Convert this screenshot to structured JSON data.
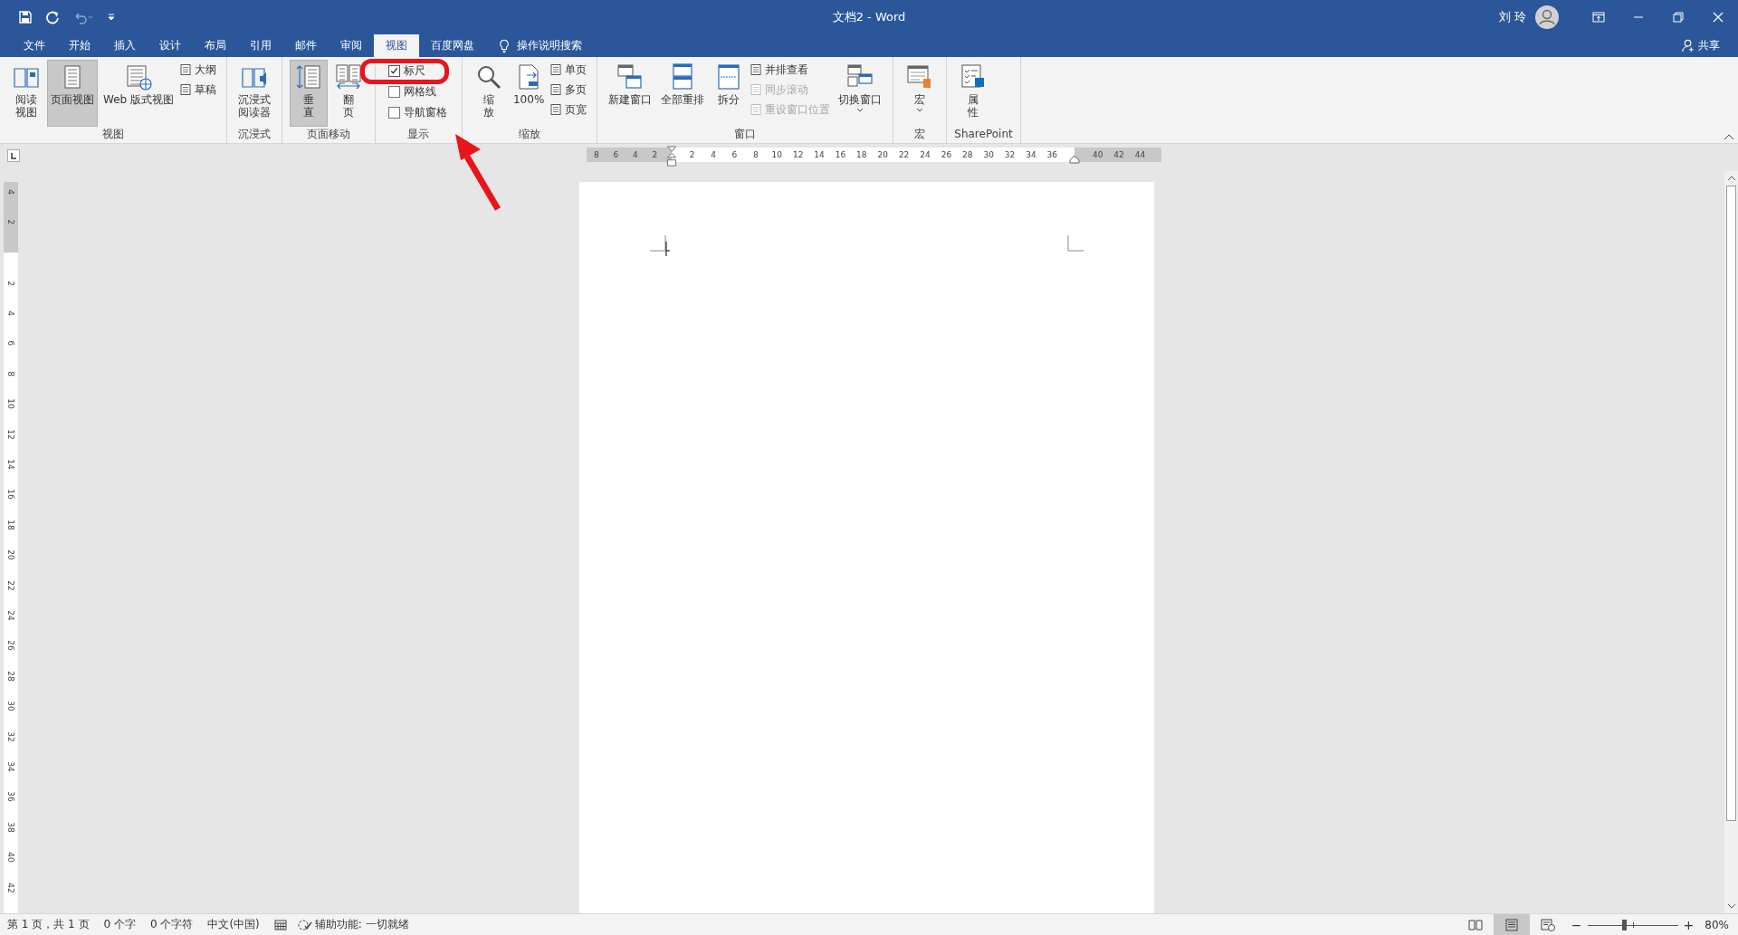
{
  "title_bar": {
    "title": "文档2 - Word",
    "user": "刘 玲"
  },
  "tabs": [
    {
      "label": "文件",
      "selected": false
    },
    {
      "label": "开始",
      "selected": false
    },
    {
      "label": "插入",
      "selected": false
    },
    {
      "label": "设计",
      "selected": false
    },
    {
      "label": "布局",
      "selected": false
    },
    {
      "label": "引用",
      "selected": false
    },
    {
      "label": "邮件",
      "selected": false
    },
    {
      "label": "审阅",
      "selected": false
    },
    {
      "label": "视图",
      "selected": true
    },
    {
      "label": "百度网盘",
      "selected": false
    }
  ],
  "tell_me": "操作说明搜索",
  "share": "共享",
  "ribbon": [
    {
      "label": "视图",
      "items": [
        {
          "kind": "large",
          "lines": [
            "阅读",
            "视图"
          ],
          "selected": false
        },
        {
          "kind": "large",
          "lines": [
            "页面视图"
          ],
          "selected": true
        },
        {
          "kind": "large",
          "lines": [
            "Web 版式视图"
          ],
          "selected": false
        },
        {
          "kind": "stack",
          "items": [
            {
              "label": "大纲",
              "disabled": false
            },
            {
              "label": "草稿",
              "disabled": false
            }
          ]
        }
      ]
    },
    {
      "label": "沉浸式",
      "items": [
        {
          "kind": "large",
          "lines": [
            "沉浸式",
            "阅读器"
          ],
          "selected": false
        }
      ]
    },
    {
      "label": "页面移动",
      "items": [
        {
          "kind": "large",
          "lines": [
            "垂",
            "直"
          ],
          "selected": true
        },
        {
          "kind": "large",
          "lines": [
            "翻",
            "页"
          ],
          "selected": false
        }
      ]
    },
    {
      "label": "显示",
      "items": [
        {
          "kind": "checks",
          "items": [
            {
              "label": "标尺",
              "checked": true
            },
            {
              "label": "网格线",
              "checked": false
            },
            {
              "label": "导航窗格",
              "checked": false
            }
          ]
        }
      ]
    },
    {
      "label": "缩放",
      "items": [
        {
          "kind": "large",
          "lines": [
            "缩",
            "放"
          ],
          "selected": false
        },
        {
          "kind": "large",
          "lines": [
            "100%"
          ],
          "selected": false
        },
        {
          "kind": "stack",
          "items": [
            {
              "label": "单页",
              "disabled": false
            },
            {
              "label": "多页",
              "disabled": false
            },
            {
              "label": "页宽",
              "disabled": false
            }
          ]
        }
      ]
    },
    {
      "label": "窗口",
      "items": [
        {
          "kind": "large",
          "lines": [
            "新建窗口"
          ],
          "selected": false
        },
        {
          "kind": "large",
          "lines": [
            "全部重排"
          ],
          "selected": false
        },
        {
          "kind": "large",
          "lines": [
            "拆分"
          ],
          "selected": false
        },
        {
          "kind": "stack",
          "items": [
            {
              "label": "并排查看",
              "disabled": false
            },
            {
              "label": "同步滚动",
              "disabled": true
            },
            {
              "label": "重设窗口位置",
              "disabled": true
            }
          ]
        },
        {
          "kind": "large",
          "lines": [
            "切换窗口"
          ],
          "selected": false,
          "dropdown": true
        }
      ]
    },
    {
      "label": "宏",
      "items": [
        {
          "kind": "large",
          "lines": [
            "宏"
          ],
          "selected": false,
          "dropdown": true
        }
      ]
    },
    {
      "label": "SharePoint",
      "items": [
        {
          "kind": "large",
          "lines": [
            "属",
            "性"
          ],
          "selected": false
        }
      ]
    }
  ],
  "ruler": {
    "left_margin_labels": [
      "8",
      "6",
      "4",
      "2"
    ],
    "text_labels": [
      "2",
      "4",
      "6",
      "8",
      "10",
      "12",
      "14",
      "16",
      "18",
      "20",
      "22",
      "24",
      "26",
      "28",
      "30",
      "32",
      "34",
      "36"
    ],
    "right_margin_labels": [
      "40",
      "42",
      "44"
    ]
  },
  "vertical_ruler": {
    "top_margin_labels": [
      "4",
      "2"
    ],
    "text_labels": [
      "2",
      "4",
      "6",
      "8",
      "10",
      "12",
      "14",
      "16",
      "18",
      "20",
      "22",
      "24",
      "26",
      "28",
      "30",
      "32",
      "34",
      "36",
      "38",
      "40",
      "42"
    ]
  },
  "status_bar": {
    "items": [
      "第 1 页，共 1 页",
      "0 个字",
      "0 个字符",
      "中文(中国)"
    ],
    "accessibility": "辅助功能: 一切就绪",
    "views": [
      {
        "selected": false
      },
      {
        "selected": true
      },
      {
        "selected": false
      }
    ],
    "zoom": {
      "minus": "−",
      "plus": "+",
      "level": 0.4,
      "percent": "80%"
    }
  }
}
